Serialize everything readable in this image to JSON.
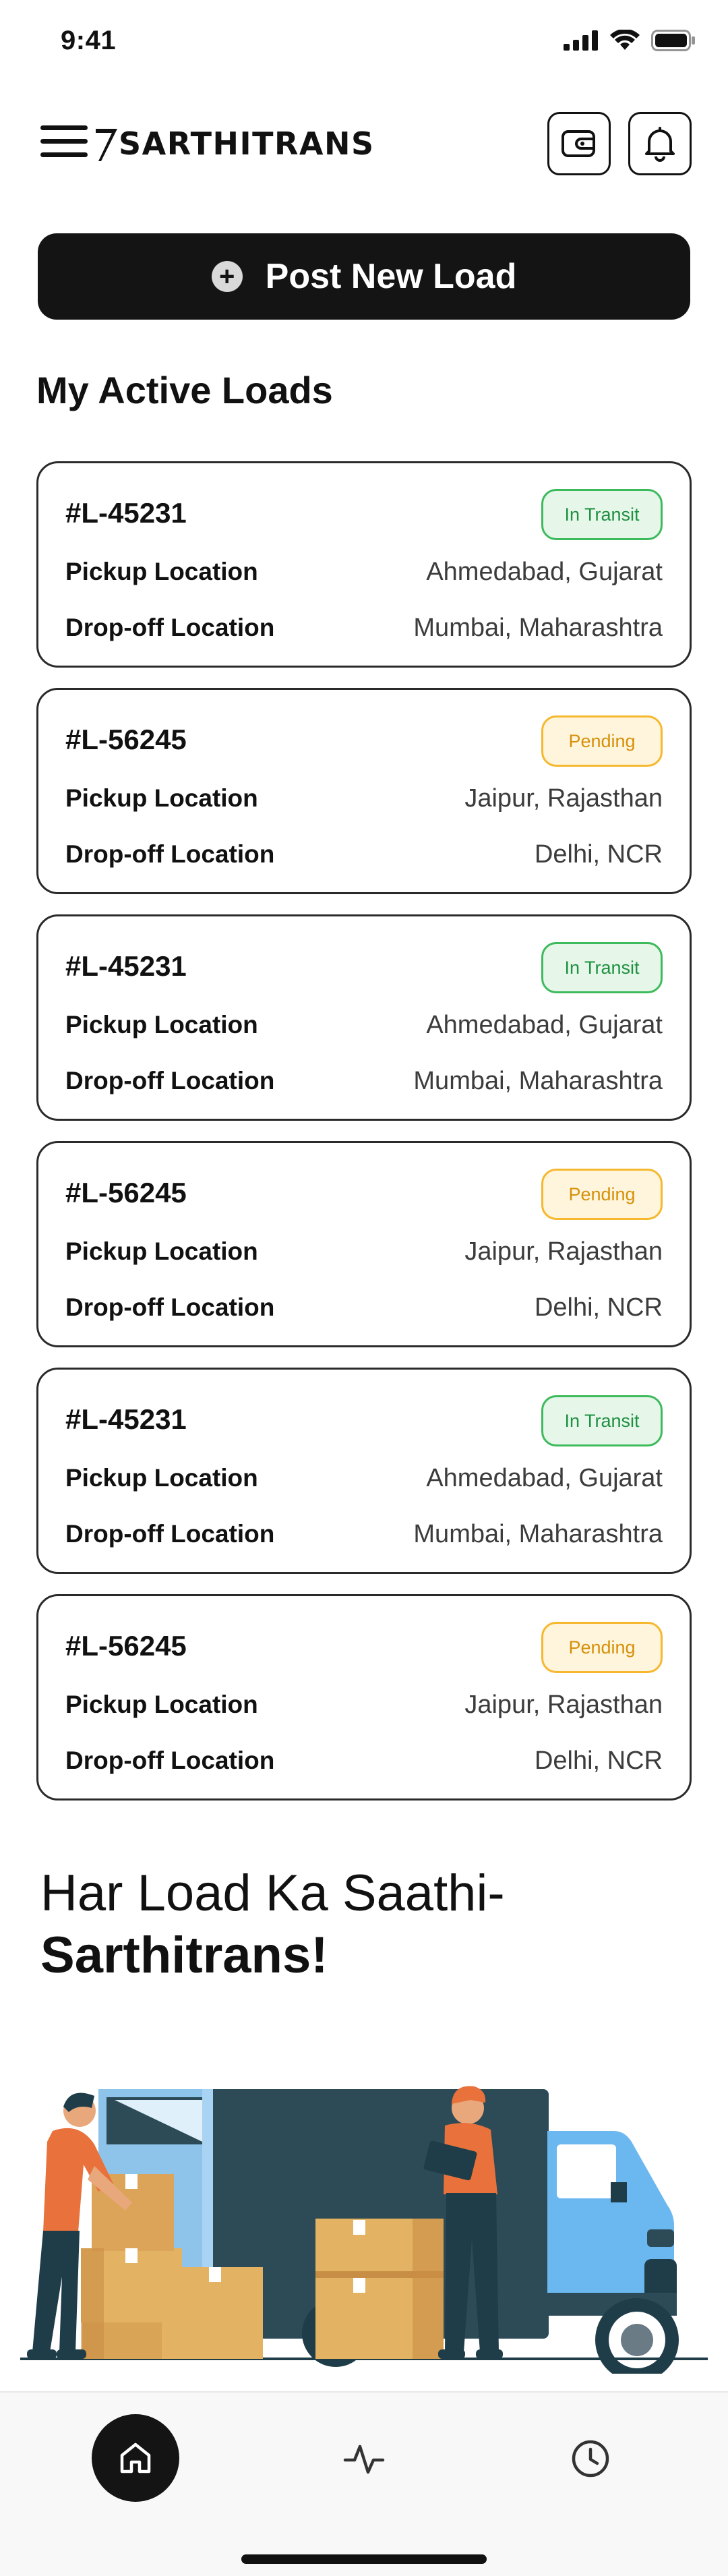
{
  "status_bar": {
    "time": "9:41"
  },
  "header": {
    "brand": "SARTHITRANS",
    "wallet_icon": "wallet-icon",
    "notification_icon": "bell-icon",
    "menu_icon": "hamburger-menu-icon"
  },
  "post_load": {
    "label": "Post New Load",
    "icon": "plus-circle-icon"
  },
  "section_title": "My Active Loads",
  "loads": [
    {
      "id": "#L-45231",
      "status": "In Transit",
      "pickup_label": "Pickup Location",
      "pickup": "Ahmedabad, Gujarat",
      "dropoff_label": "Drop-off Location",
      "dropoff": "Mumbai, Maharashtra"
    },
    {
      "id": "#L-56245",
      "status": "Pending",
      "pickup_label": "Pickup Location",
      "pickup": "Jaipur, Rajasthan",
      "dropoff_label": "Drop-off Location",
      "dropoff": "Delhi, NCR"
    },
    {
      "id": "#L-45231",
      "status": "In Transit",
      "pickup_label": "Pickup Location",
      "pickup": "Ahmedabad, Gujarat",
      "dropoff_label": "Drop-off Location",
      "dropoff": "Mumbai, Maharashtra"
    },
    {
      "id": "#L-56245",
      "status": "Pending",
      "pickup_label": "Pickup Location",
      "pickup": "Jaipur, Rajasthan",
      "dropoff_label": "Drop-off Location",
      "dropoff": "Delhi, NCR"
    },
    {
      "id": "#L-45231",
      "status": "In Transit",
      "pickup_label": "Pickup Location",
      "pickup": "Ahmedabad, Gujarat",
      "dropoff_label": "Drop-off Location",
      "dropoff": "Mumbai, Maharashtra"
    },
    {
      "id": "#L-56245",
      "status": "Pending",
      "pickup_label": "Pickup Location",
      "pickup": "Jaipur, Rajasthan",
      "dropoff_label": "Drop-off Location",
      "dropoff": "Delhi, NCR"
    }
  ],
  "tagline": {
    "line1": "Har Load Ka Saathi-",
    "line2": "Sarthitrans!"
  },
  "bottom_nav": {
    "items": [
      "home-icon",
      "activity-icon",
      "clock-icon"
    ],
    "active": "home"
  },
  "colors": {
    "primary": "#141414",
    "transit_bg": "#e6f7ea",
    "transit_border": "#3dba5c",
    "pending_bg": "#fff5dc",
    "pending_border": "#f5b82e"
  }
}
